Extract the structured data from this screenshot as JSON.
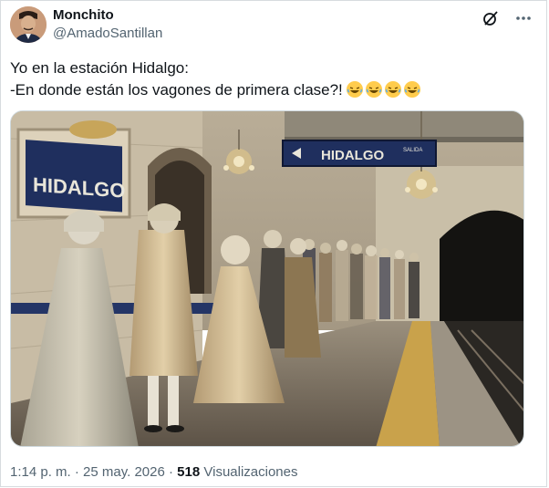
{
  "author": {
    "name": "Monchito",
    "handle": "@AmadoSantillan"
  },
  "tweet": {
    "line1": "Yo en la estación Hidalgo:",
    "line2": "-En donde están los vagones de primera clase?!",
    "emoji_icon": "rolling-on-floor-laughing-emoji",
    "emoji_count": 4
  },
  "media": {
    "station_sign": "HIDALGO",
    "wall_sign": "HIDALGO",
    "exit_label": "SALIDA"
  },
  "footer": {
    "time": "1:14 p. m.",
    "separator1": "·",
    "date": "25 may. 2026",
    "separator2": "·",
    "views_count": "518",
    "views_label": "Visualizaciones"
  },
  "colors": {
    "text": "#0f1419",
    "secondary": "#536471",
    "sign_blue": "#1f2f5e",
    "border": "#cfd9de"
  }
}
